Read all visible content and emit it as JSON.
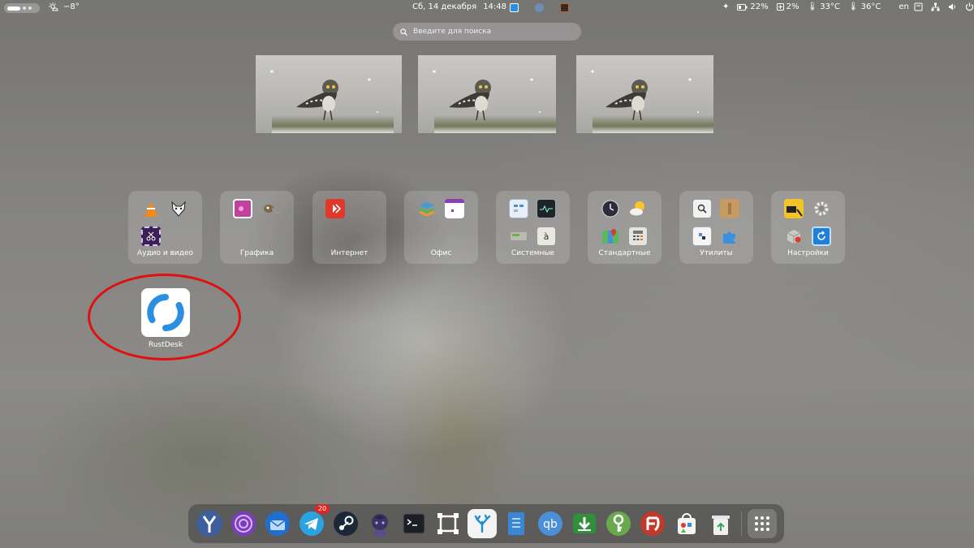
{
  "topbar": {
    "weather_temp": "−8°",
    "date": "Сб, 14 декабря",
    "time": "14:48",
    "battery1": "22%",
    "battery2": "2%",
    "temp_cpu": "33°C",
    "temp_gpu": "36°C",
    "keyboard_layout": "en"
  },
  "search": {
    "placeholder": "Введите для поиска"
  },
  "folders": [
    {
      "label": "Аудио и видео"
    },
    {
      "label": "Графика"
    },
    {
      "label": "Интернет"
    },
    {
      "label": "Офис"
    },
    {
      "label": "Системные"
    },
    {
      "label": "Стандартные"
    },
    {
      "label": "Утилиты"
    },
    {
      "label": "Настройки"
    }
  ],
  "apps": [
    {
      "label": "RustDesk"
    }
  ],
  "dock": {
    "telegram_badge": "20",
    "items": [
      "yandex-browser-icon",
      "tor-browser-icon",
      "thunderbird-icon",
      "telegram-icon",
      "steam-icon",
      "anime-game-icon",
      "terminal-icon",
      "screenshot-tool-icon",
      "coral-app-icon",
      "text-editor-icon",
      "qbittorrent-icon",
      "download-manager-icon",
      "keepass-icon",
      "filezilla-icon",
      "software-store-icon",
      "trash-icon",
      "app-grid-icon"
    ]
  },
  "colors": {
    "accent_red": "#e10f0f",
    "rustdesk_blue": "#2a8fe0",
    "dock_bg": "#464646"
  }
}
